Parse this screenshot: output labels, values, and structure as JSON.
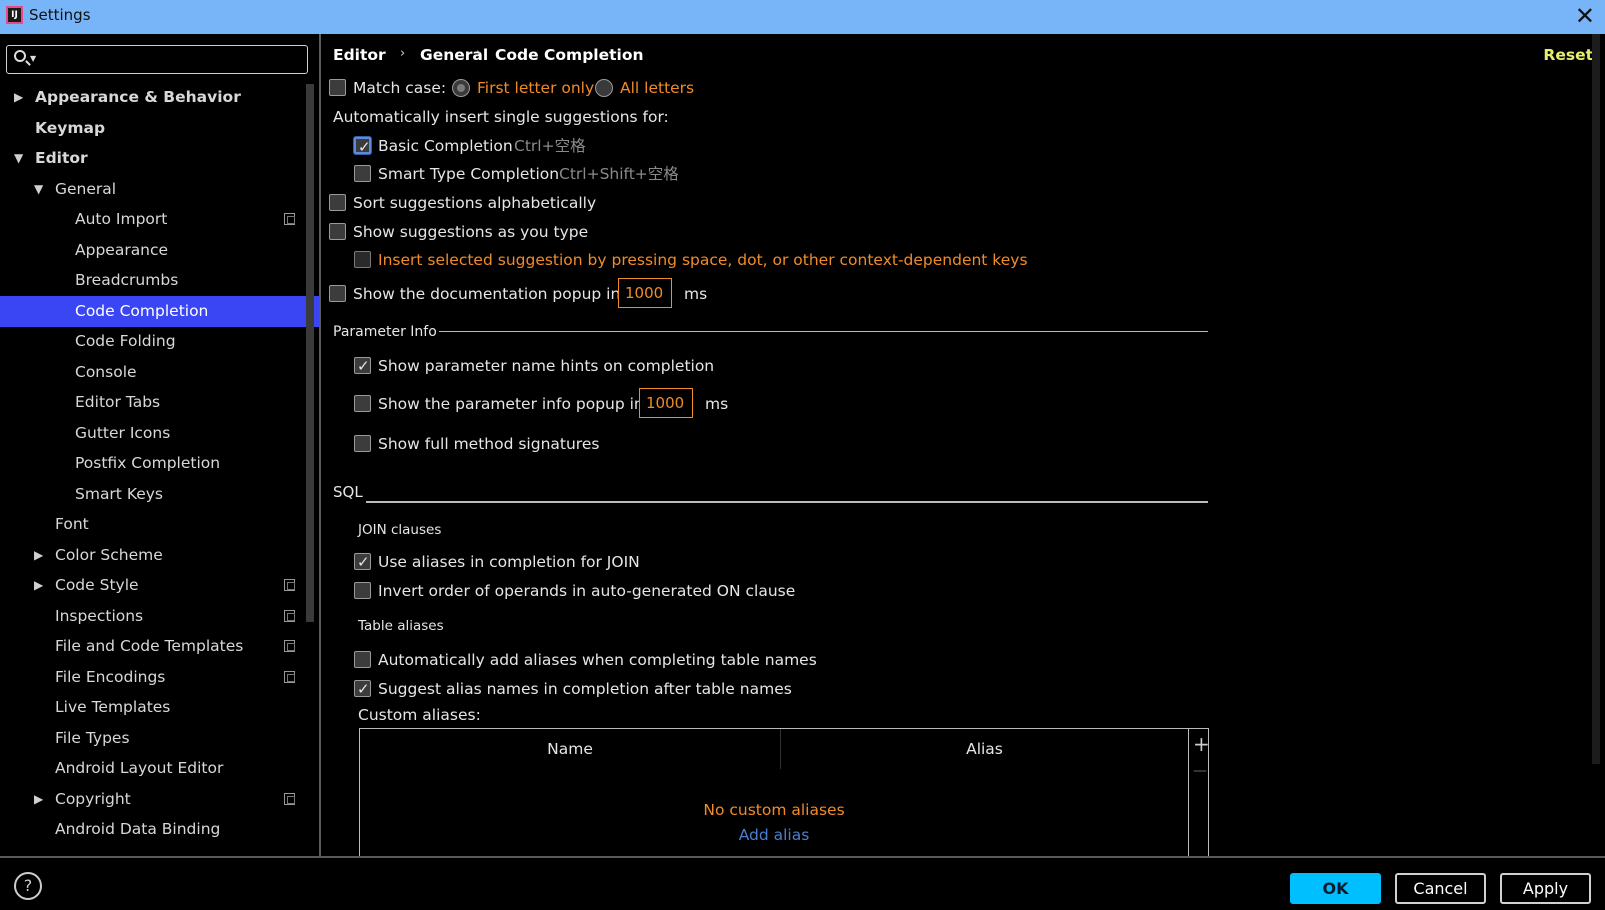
{
  "window": {
    "title": "Settings",
    "app_icon_text": "IJ",
    "close_icon": "close-icon"
  },
  "search": {
    "value": "",
    "placeholder": ""
  },
  "sidebar": {
    "items": [
      {
        "label": "Appearance & Behavior",
        "arrow": "▶"
      },
      {
        "label": "Keymap"
      },
      {
        "label": "Editor",
        "arrow": "▼"
      },
      {
        "label": "General",
        "arrow": "▼"
      },
      {
        "label": "Auto Import"
      },
      {
        "label": "Appearance"
      },
      {
        "label": "Breadcrumbs"
      },
      {
        "label": "Code Completion"
      },
      {
        "label": "Code Folding"
      },
      {
        "label": "Console"
      },
      {
        "label": "Editor Tabs"
      },
      {
        "label": "Gutter Icons"
      },
      {
        "label": "Postfix Completion"
      },
      {
        "label": "Smart Keys"
      },
      {
        "label": "Font"
      },
      {
        "label": "Color Scheme",
        "arrow": "▶"
      },
      {
        "label": "Code Style",
        "arrow": "▶"
      },
      {
        "label": "Inspections"
      },
      {
        "label": "File and Code Templates"
      },
      {
        "label": "File Encodings"
      },
      {
        "label": "Live Templates"
      },
      {
        "label": "File Types"
      },
      {
        "label": "Android Layout Editor"
      },
      {
        "label": "Copyright",
        "arrow": "▶"
      },
      {
        "label": "Android Data Binding"
      }
    ]
  },
  "breadcrumb": {
    "items": [
      "Editor",
      "General",
      "Code Completion"
    ],
    "separator": "›"
  },
  "reset_label": "Reset",
  "settings": {
    "match_case": {
      "label": "Match case:",
      "checked": false
    },
    "first_letter_only": "First letter only",
    "all_letters": "All letters",
    "auto_insert_label": "Automatically insert single suggestions for:",
    "basic_completion": {
      "label": "Basic Completion",
      "shortcut": "Ctrl+空格",
      "checked": true
    },
    "smart_type_completion": {
      "label": "Smart Type Completion",
      "shortcut": "Ctrl+Shift+空格",
      "checked": false
    },
    "sort_alpha": {
      "label": "Sort suggestions alphabetically",
      "checked": false
    },
    "show_as_you_type": {
      "label": "Show suggestions as you type",
      "checked": false
    },
    "insert_selected": {
      "label": "Insert selected suggestion by pressing space, dot, or other context-dependent keys",
      "checked": false
    },
    "doc_popup": {
      "label": "Show the documentation popup in",
      "value": "1000",
      "unit": "ms",
      "checked": false
    }
  },
  "parameter_info": {
    "title": "Parameter Info",
    "show_name_hints": {
      "label": "Show parameter name hints on completion",
      "checked": true
    },
    "info_popup": {
      "label": "Show the parameter info popup in",
      "value": "1000",
      "unit": "ms",
      "checked": false
    },
    "full_signatures": {
      "label": "Show full method signatures",
      "checked": false
    }
  },
  "sql": {
    "title": "SQL",
    "join_title": "JOIN clauses",
    "use_aliases": {
      "label": "Use aliases in completion for JOIN",
      "checked": true
    },
    "invert_order": {
      "label": "Invert order of operands in auto-generated ON clause",
      "checked": false
    },
    "table_aliases_title": "Table aliases",
    "auto_add_aliases": {
      "label": "Automatically add aliases when completing table names",
      "checked": false
    },
    "suggest_alias": {
      "label": "Suggest alias names in completion after table names",
      "checked": true
    },
    "custom_aliases_label": "Custom aliases:",
    "table": {
      "columns": [
        "Name",
        "Alias"
      ],
      "empty_text": "No custom aliases",
      "add_link": "Add alias",
      "add_icon": "+",
      "remove_icon": "—"
    }
  },
  "footer": {
    "help_icon": "?",
    "ok": "OK",
    "cancel": "Cancel",
    "apply": "Apply"
  },
  "colors": {
    "selection": "#3a45f4",
    "accent_orange": "#f08b2a",
    "reset_yellow": "#e6ee6e",
    "ok_button": "#00bfff",
    "titlebar": "#78b4f8"
  }
}
